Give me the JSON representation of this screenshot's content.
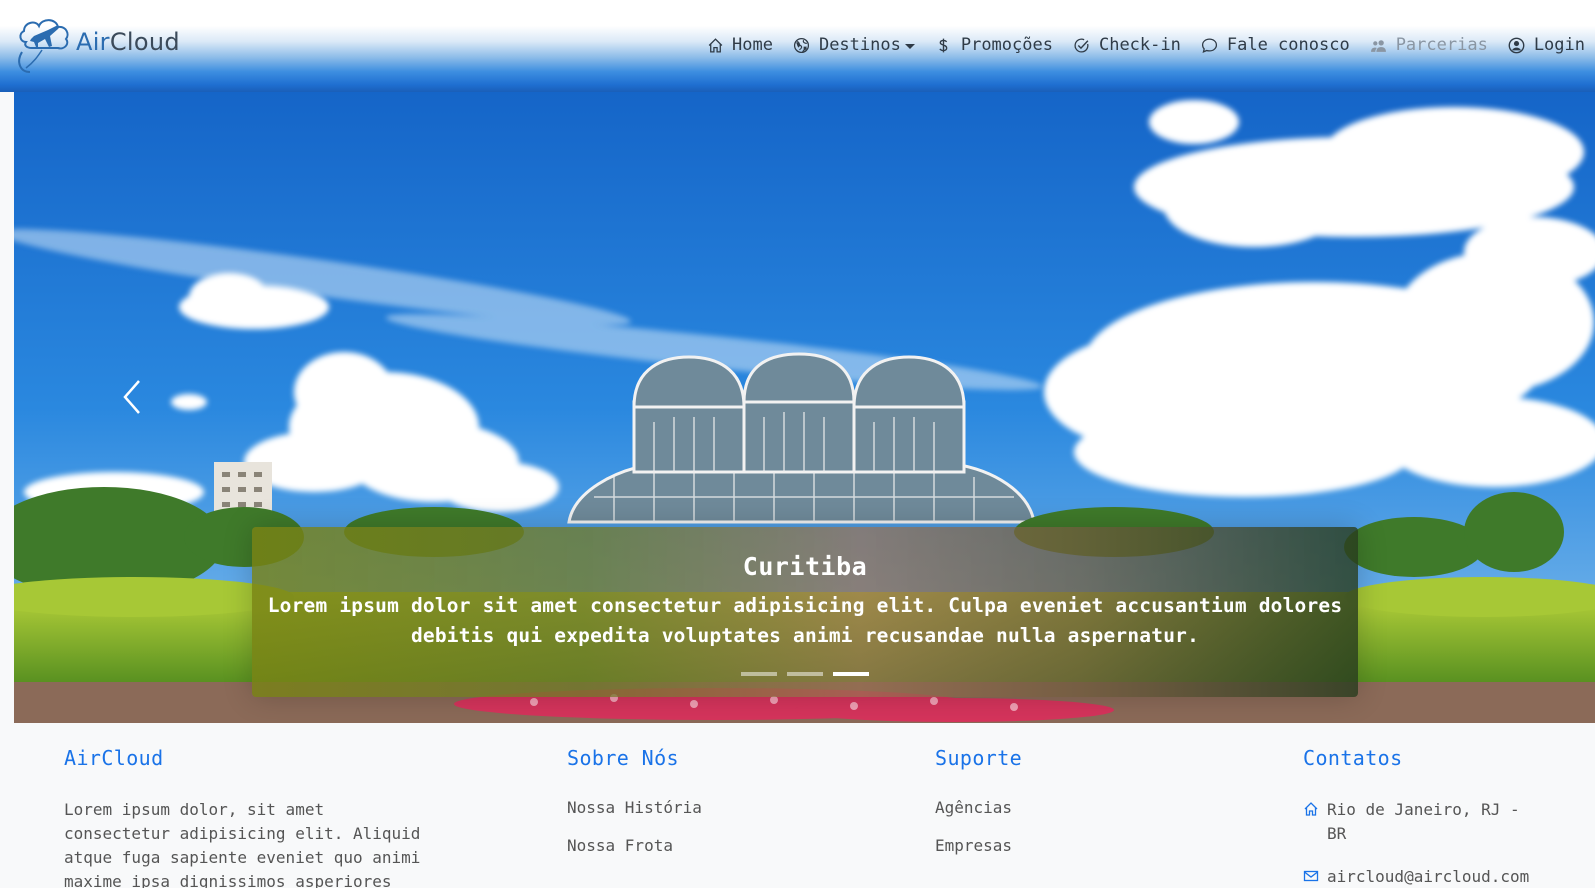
{
  "brand": {
    "part1": "Air",
    "part2": "Cloud"
  },
  "nav": {
    "items": [
      {
        "label": "Home",
        "icon": "home-icon"
      },
      {
        "label": "Destinos",
        "icon": "globe-icon",
        "dropdown": true
      },
      {
        "label": "Promoções",
        "icon": "dollar-icon"
      },
      {
        "label": "Check-in",
        "icon": "check-circle-icon"
      },
      {
        "label": "Fale conosco",
        "icon": "chat-icon"
      },
      {
        "label": "Parcerias",
        "icon": "people-icon",
        "disabled": true
      },
      {
        "label": "Login",
        "icon": "person-circle-icon"
      }
    ]
  },
  "carousel": {
    "caption_title": "Curitiba",
    "caption_text": "Lorem ipsum dolor sit amet consectetur adipisicing elit. Culpa eveniet accusantium dolores debitis qui expedita voluptates animi recusandae nulla aspernatur.",
    "slides": 3,
    "active_slide": 3
  },
  "footer": {
    "about": {
      "title": "AirCloud",
      "text": "Lorem ipsum dolor, sit amet consectetur adipisicing elit. Aliquid atque fuga sapiente eveniet quo animi maxime ipsa dignissimos asperiores"
    },
    "sobre": {
      "title": "Sobre Nós",
      "links": [
        "Nossa História",
        "Nossa Frota"
      ]
    },
    "suporte": {
      "title": "Suporte",
      "links": [
        "Agências",
        "Empresas"
      ]
    },
    "contatos": {
      "title": "Contatos",
      "address": "Rio de Janeiro, RJ - BR",
      "email": "aircloud@aircloud.com"
    }
  },
  "colors": {
    "accent": "#1a73e8",
    "nav_gradient_bottom": "#1a5fb8",
    "sky": "#1f7fd6"
  }
}
